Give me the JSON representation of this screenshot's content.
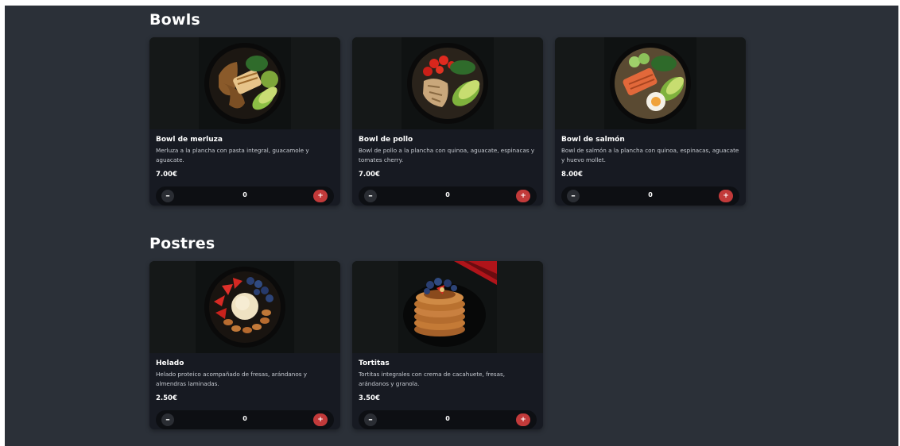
{
  "sections": [
    {
      "title": "Bowls",
      "items": [
        {
          "name": "Bowl de merluza",
          "description": "Merluza a la plancha con pasta integral, guacamole y aguacate.",
          "price": "7.00€",
          "quantity": "0",
          "minus": "–",
          "plus": "+"
        },
        {
          "name": "Bowl de pollo",
          "description": "Bowl de pollo a la plancha con quinoa, aguacate, espinacas y tomates cherry.",
          "price": "7.00€",
          "quantity": "0",
          "minus": "–",
          "plus": "+"
        },
        {
          "name": "Bowl de salmón",
          "description": "Bowl de salmón a la plancha con quinoa, espinacas, aguacate y huevo mollet.",
          "price": "8.00€",
          "quantity": "0",
          "minus": "–",
          "plus": "+"
        }
      ]
    },
    {
      "title": "Postres",
      "items": [
        {
          "name": "Helado",
          "description": "Helado proteico acompañado de fresas, arándanos y almendras laminadas.",
          "price": "2.50€",
          "quantity": "0",
          "minus": "–",
          "plus": "+"
        },
        {
          "name": "Tortitas",
          "description": "Tortitas integrales con crema de cacahuete, fresas, arándanos y granola.",
          "price": "3.50€",
          "quantity": "0",
          "minus": "–",
          "plus": "+"
        }
      ]
    }
  ],
  "colors": {
    "background": "#2b3038",
    "card": "#171a22",
    "accent": "#c23a3a"
  }
}
